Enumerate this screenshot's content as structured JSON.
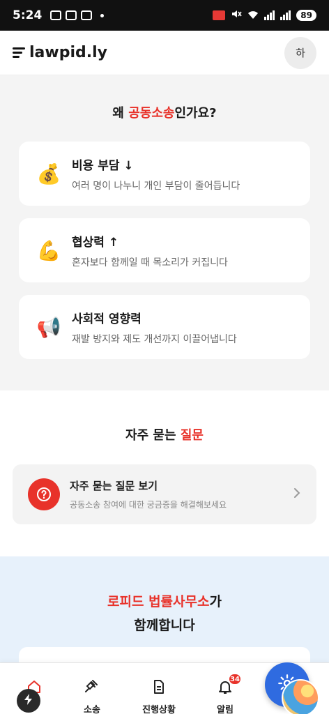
{
  "status_bar": {
    "time": "5:24",
    "battery": "89"
  },
  "app_bar": {
    "logo_text": "lawpid.ly",
    "avatar_initial": "하"
  },
  "why_section": {
    "title_prefix": "왜 ",
    "title_accent": "공동소송",
    "title_suffix": "인가요?",
    "cards": [
      {
        "emoji": "💰",
        "icon": "money-bag-icon",
        "title": "비용 부담 ↓",
        "desc": "여러 명이 나누니 개인 부담이 줄어듭니다"
      },
      {
        "emoji": "💪",
        "icon": "flexed-arm-icon",
        "title": "협상력 ↑",
        "desc": "혼자보다 함께일 때 목소리가 커집니다"
      },
      {
        "emoji": "📢",
        "icon": "megaphone-icon",
        "title": "사회적 영향력",
        "desc": "재발 방지와 제도 개선까지 이끌어냅니다"
      }
    ]
  },
  "faq_section": {
    "title_prefix": "자주 묻는 ",
    "title_accent": "질문",
    "card_title": "자주 묻는 질문 보기",
    "card_desc": "공동소송 참여에 대한 궁금증을 해결해보세요"
  },
  "partner_section": {
    "line1_accent": "로피드 법률사무소",
    "line1_suffix": "가",
    "line2": "함께합니다"
  },
  "bottom_nav": {
    "items": [
      {
        "label": "소송",
        "icon": "gavel-icon"
      },
      {
        "label": "진행상황",
        "icon": "document-icon"
      },
      {
        "label": "알림",
        "icon": "bell-icon",
        "badge": "34"
      }
    ]
  },
  "colors": {
    "accent": "#e8322a",
    "fab": "#2f6be0",
    "partner_bg": "#e7f1fb"
  }
}
